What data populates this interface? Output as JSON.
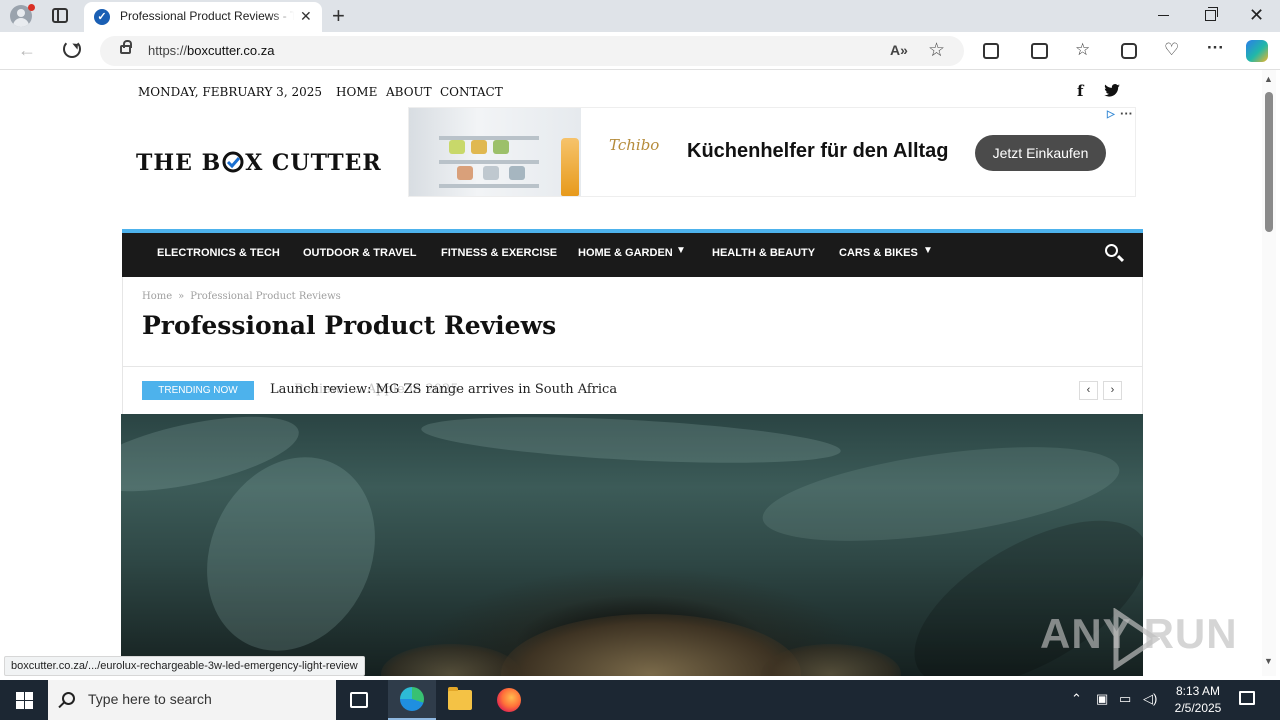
{
  "browser": {
    "tab_title": "Professional Product Reviews - The Box Cutter",
    "url_scheme": "https://",
    "url_host": "boxcutter.co.za",
    "status_url": "boxcutter.co.za/.../eurolux-rechargeable-3w-led-emergency-light-review"
  },
  "site": {
    "date": "MONDAY, FEBRUARY 3, 2025",
    "topnav": [
      "HOME",
      "ABOUT",
      "CONTACT"
    ],
    "logo_pre": "THE B",
    "logo_post": "X CUTTER",
    "ad": {
      "brand": "Tchibo",
      "headline": "Küchenhelfer für den Alltag",
      "cta": "Jetzt Einkaufen"
    },
    "mainnav": [
      "ELECTRONICS & TECH",
      "OUTDOOR & TRAVEL",
      "FITNESS & EXERCISE",
      "HOME & GARDEN",
      "HEALTH & BEAUTY",
      "CARS & BIKES"
    ],
    "breadcrumb": [
      "Home",
      "Professional Product Reviews"
    ],
    "breadcrumb_sep": "»",
    "page_title": "Professional Product Reviews",
    "trending_label": "TRENDING NOW",
    "trending_current": "Launch review: MG ZS range arrives in South Africa",
    "trending_fading": "Review: ... Apple in 2025"
  },
  "watermark": "ANY RUN",
  "taskbar": {
    "search_placeholder": "Type here to search",
    "time": "8:13 AM",
    "date": "2/5/2025"
  },
  "colors": {
    "accent": "#4db2ec",
    "nav_bg": "#1a1a1a",
    "taskbar_bg": "#1c2733"
  },
  "icons": [
    "profile-icon",
    "tab-actions-icon",
    "tab-favicon-icon",
    "close-icon",
    "new-tab-icon",
    "back-icon",
    "reload-icon",
    "lock-icon",
    "read-aloud-icon",
    "favorite-star-icon",
    "extensions-icon",
    "split-screen-icon",
    "favorites-icon",
    "collections-icon",
    "browser-essentials-icon",
    "more-icon",
    "copilot-icon",
    "facebook-icon",
    "twitter-icon",
    "search-icon",
    "chevron-down-icon",
    "chevron-left-icon",
    "chevron-right-icon",
    "windows-start-icon",
    "task-view-icon",
    "edge-icon",
    "file-explorer-icon",
    "firefox-icon",
    "notification-icon"
  ]
}
